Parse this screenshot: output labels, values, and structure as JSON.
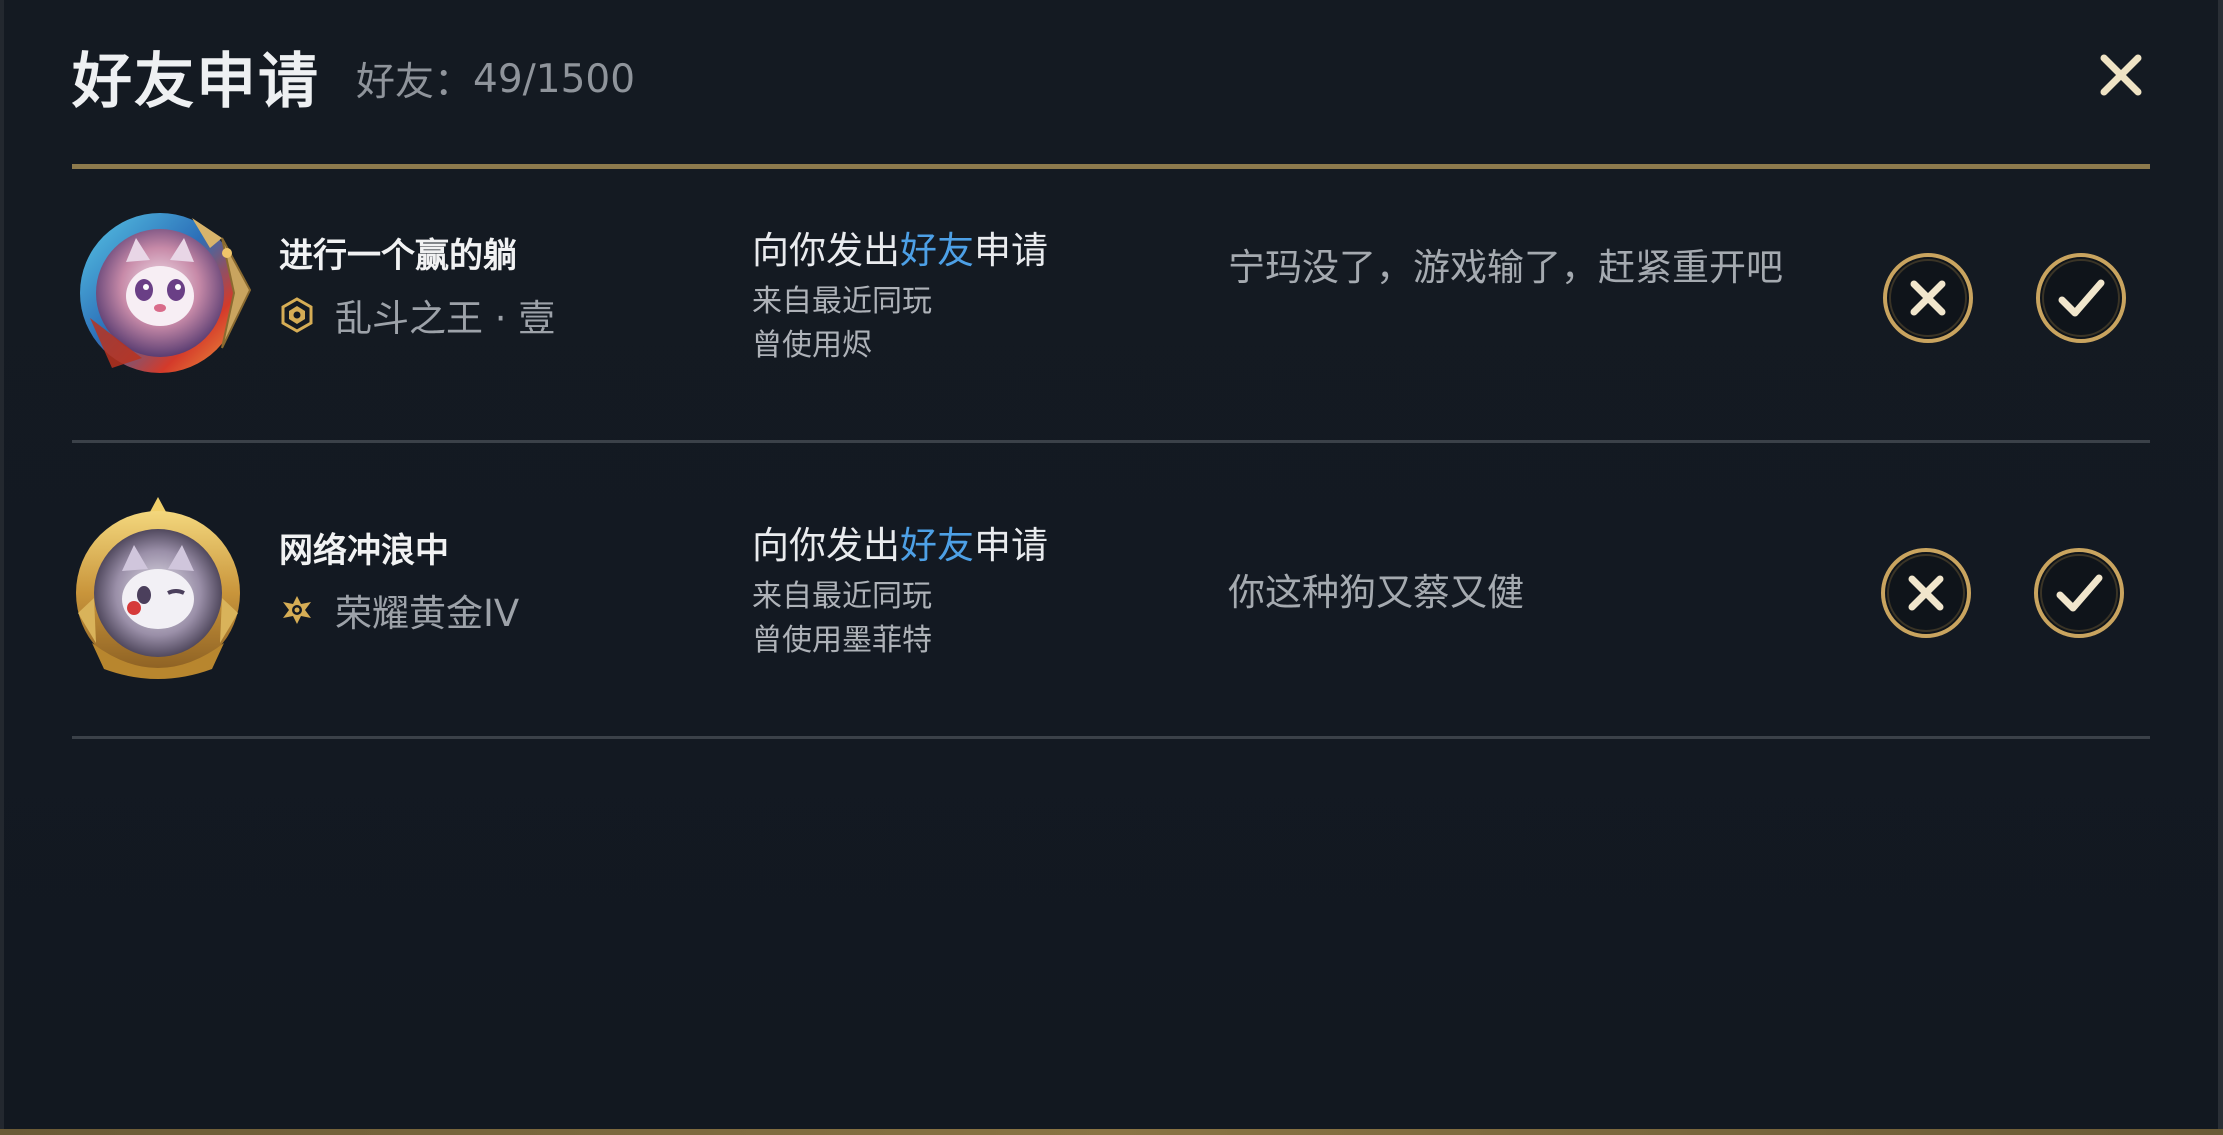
{
  "header": {
    "title": "好友申请",
    "friend_count_label": "好友：",
    "friend_count_value": "49/1500"
  },
  "requests": [
    {
      "player_name": "进行一个赢的躺",
      "rank_name": "乱斗之王 · 壹",
      "request_prefix": "向你发出",
      "request_highlight": "好友",
      "request_suffix": "申请",
      "source": "来自最近同玩",
      "used_champion": "曾使用烬",
      "message": "宁玛没了，游戏输了，赶紧重开吧"
    },
    {
      "player_name": "网络冲浪中",
      "rank_name": "荣耀黄金IV",
      "request_prefix": "向你发出",
      "request_highlight": "好友",
      "request_suffix": "申请",
      "source": "来自最近同玩",
      "used_champion": "曾使用墨菲特",
      "message": "你这种狗又蔡又健"
    }
  ],
  "colors": {
    "background": "#131922",
    "gold_accent": "#c9a45f",
    "highlight_blue": "#4da0e6",
    "title_text": "#eef0f2"
  },
  "icons": {
    "close": "close-icon",
    "reject": "reject-x-icon",
    "accept": "accept-check-icon",
    "rank_aram": "aram-rank-icon",
    "rank_gold": "gold-rank-icon"
  }
}
